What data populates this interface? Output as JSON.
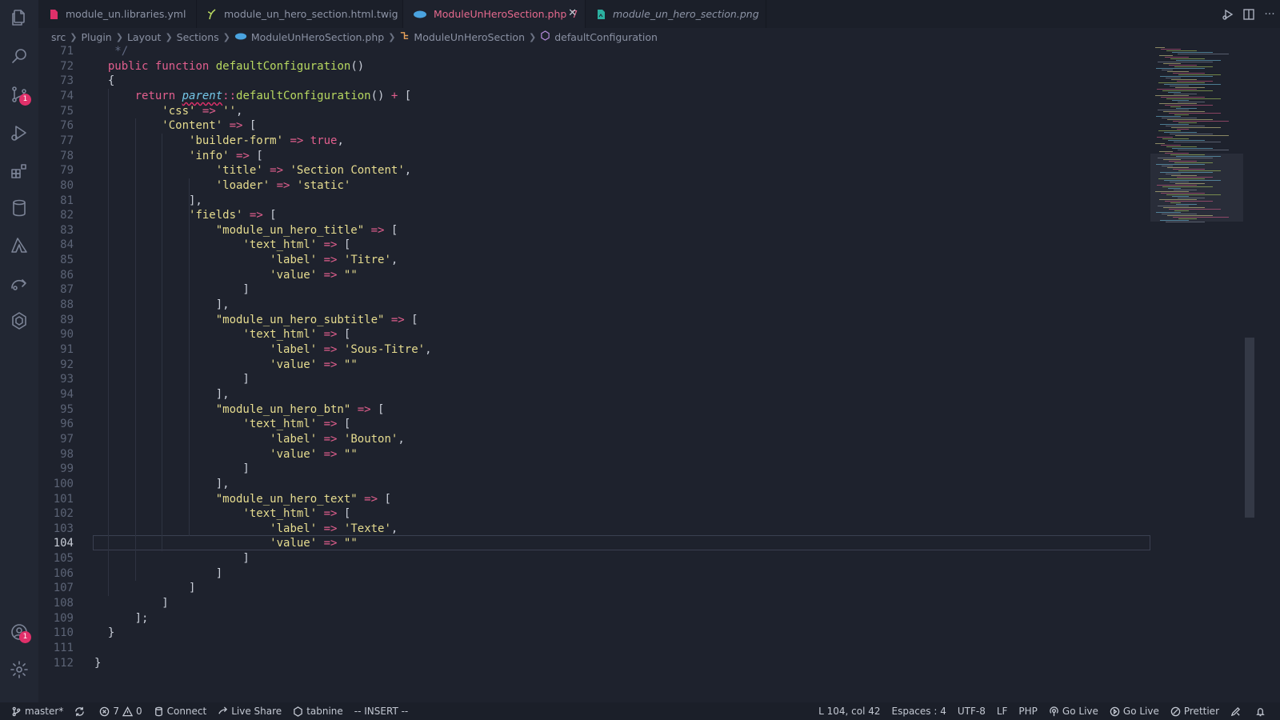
{
  "activity_bar": {
    "items": [
      "explorer-icon",
      "search-icon",
      "source-control-icon",
      "run-debug-icon",
      "extensions-icon",
      "database-icon",
      "azure-icon",
      "remote-explorer-icon",
      "kubernetes-icon"
    ],
    "source_control_badge": "1",
    "accounts_badge": "1"
  },
  "tabs": [
    {
      "label": "module_un.libraries.yml",
      "icon": "yaml-icon",
      "color": "#e0306a"
    },
    {
      "label": "module_un_hero_section.html.twig",
      "icon": "twig-icon",
      "color": "#b8d860"
    },
    {
      "label": "ModuleUnHeroSection.php",
      "problems": "7",
      "icon": "php-icon",
      "color": "#4aa3df",
      "active": true
    },
    {
      "label": "module_un_hero_section.png",
      "icon": "image-icon",
      "color": "#2bb0a0",
      "italic": true
    }
  ],
  "breadcrumb": {
    "items": [
      "src",
      "Plugin",
      "Layout",
      "Sections",
      "ModuleUnHeroSection.php",
      "ModuleUnHeroSection",
      "defaultConfiguration"
    ]
  },
  "editor": {
    "current_line": "104",
    "lines": [
      {
        "n": "71",
        "t": "   */"
      },
      {
        "n": "72",
        "t": "  public function defaultConfiguration()"
      },
      {
        "n": "73",
        "t": "  {"
      },
      {
        "n": "74",
        "t": "      return parent::defaultConfiguration() + ["
      },
      {
        "n": "75",
        "t": "          'css' => '',"
      },
      {
        "n": "76",
        "t": "          'Content' => ["
      },
      {
        "n": "77",
        "t": "              'builder-form' => true,"
      },
      {
        "n": "78",
        "t": "              'info' => ["
      },
      {
        "n": "79",
        "t": "                  'title' => 'Section Content',"
      },
      {
        "n": "80",
        "t": "                  'loader' => 'static'"
      },
      {
        "n": "81",
        "t": "              ],"
      },
      {
        "n": "82",
        "t": "              'fields' => ["
      },
      {
        "n": "83",
        "t": "                  \"module_un_hero_title\" => ["
      },
      {
        "n": "84",
        "t": "                      'text_html' => ["
      },
      {
        "n": "85",
        "t": "                          'label' => 'Titre',"
      },
      {
        "n": "86",
        "t": "                          'value' => \"\""
      },
      {
        "n": "87",
        "t": "                      ]"
      },
      {
        "n": "88",
        "t": "                  ],"
      },
      {
        "n": "89",
        "t": "                  \"module_un_hero_subtitle\" => ["
      },
      {
        "n": "90",
        "t": "                      'text_html' => ["
      },
      {
        "n": "91",
        "t": "                          'label' => 'Sous-Titre',"
      },
      {
        "n": "92",
        "t": "                          'value' => \"\""
      },
      {
        "n": "93",
        "t": "                      ]"
      },
      {
        "n": "94",
        "t": "                  ],"
      },
      {
        "n": "95",
        "t": "                  \"module_un_hero_btn\" => ["
      },
      {
        "n": "96",
        "t": "                      'text_html' => ["
      },
      {
        "n": "97",
        "t": "                          'label' => 'Bouton',"
      },
      {
        "n": "98",
        "t": "                          'value' => \"\""
      },
      {
        "n": "99",
        "t": "                      ]"
      },
      {
        "n": "100",
        "t": "                  ],"
      },
      {
        "n": "101",
        "t": "                  \"module_un_hero_text\" => ["
      },
      {
        "n": "102",
        "t": "                      'text_html' => ["
      },
      {
        "n": "103",
        "t": "                          'label' => 'Texte',"
      },
      {
        "n": "104",
        "t": "                          'value' => \"\""
      },
      {
        "n": "105",
        "t": "                      ]"
      },
      {
        "n": "106",
        "t": "                  ]"
      },
      {
        "n": "107",
        "t": "              ]"
      },
      {
        "n": "108",
        "t": "          ]"
      },
      {
        "n": "109",
        "t": "      ];"
      },
      {
        "n": "110",
        "t": "  }"
      },
      {
        "n": "111",
        "t": ""
      },
      {
        "n": "112",
        "t": "}"
      }
    ]
  },
  "statusbar": {
    "branch": "master*",
    "errors": "7",
    "warnings": "0",
    "connect": "Connect",
    "live_share": "Live Share",
    "tabnine": "tabnine",
    "mode": "-- INSERT --",
    "position": "L 104, col 42",
    "spaces": "Espaces : 4",
    "encoding": "UTF-8",
    "eol": "LF",
    "language": "PHP",
    "go_live_1": "Go Live",
    "go_live_2": "Go Live",
    "prettier": "Prettier"
  },
  "colors": {
    "accent": "#e25f8e",
    "function": "#b8d860",
    "string": "#e6dc8f",
    "background": "#1e222d"
  }
}
